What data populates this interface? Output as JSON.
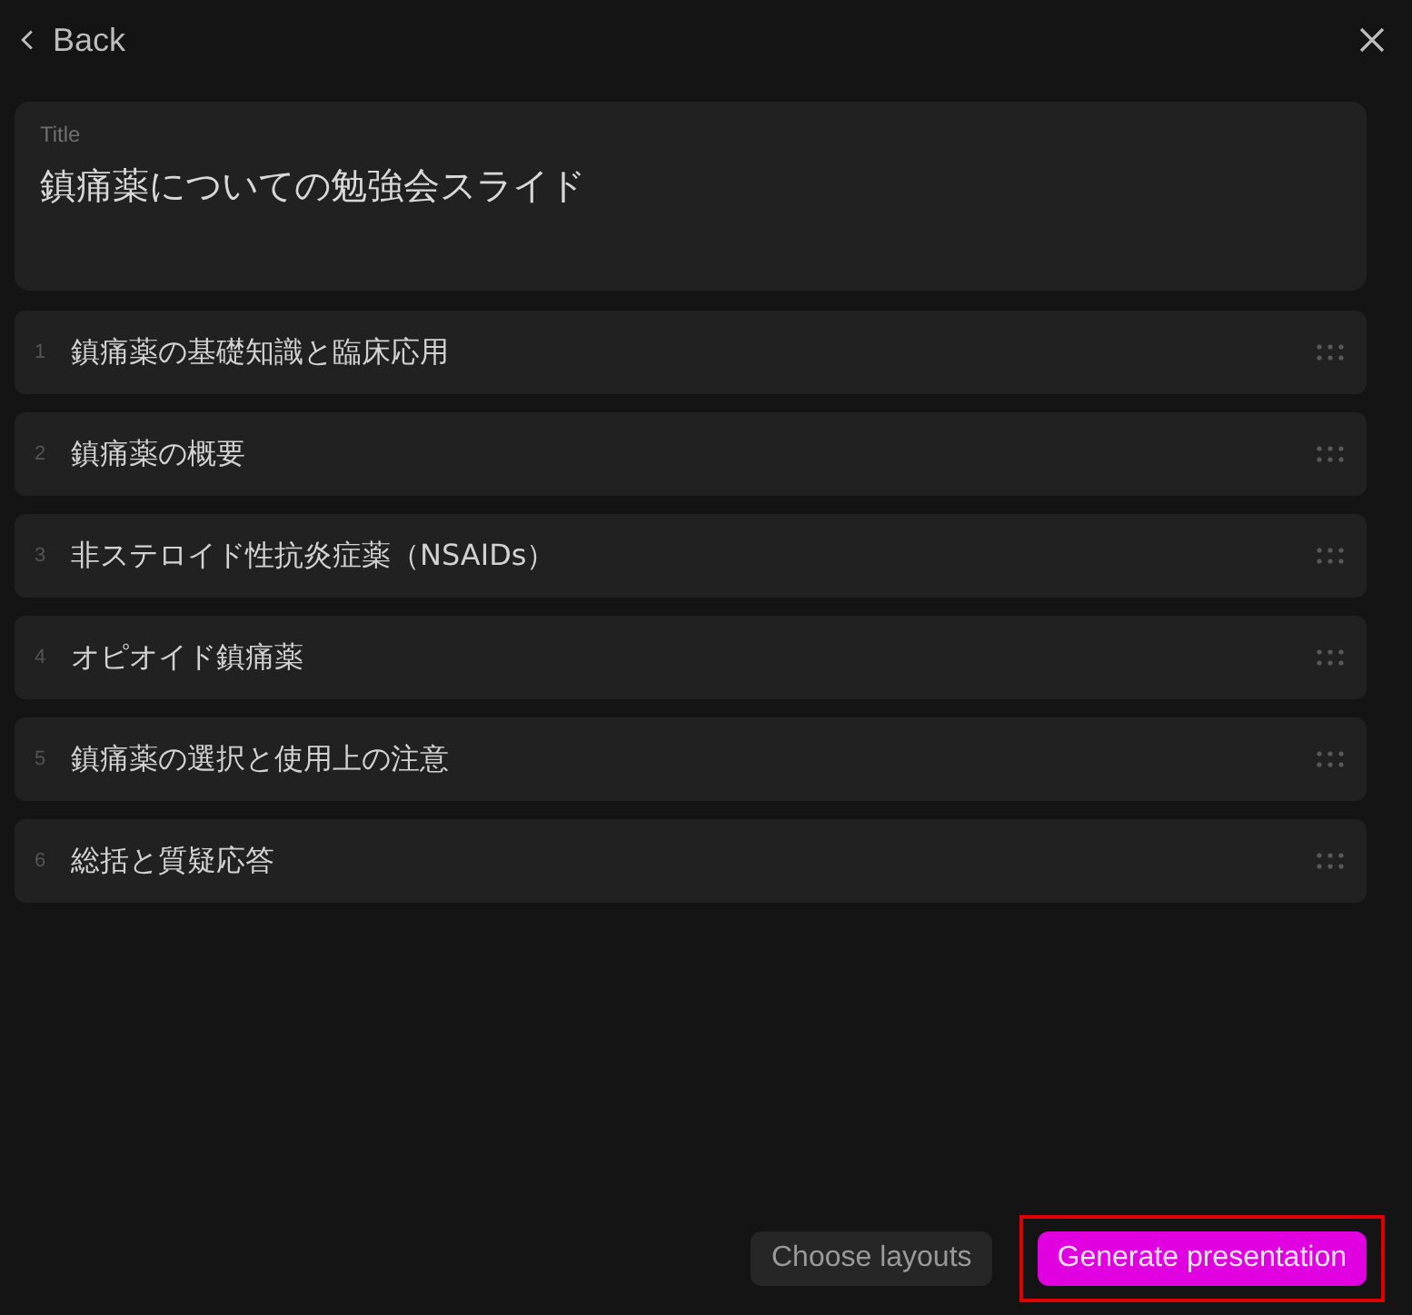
{
  "header": {
    "back_label": "Back"
  },
  "title_field": {
    "label": "Title",
    "value": "鎮痛薬についての勉強会スライド"
  },
  "outline": [
    {
      "number": "1",
      "text": "鎮痛薬の基礎知識と臨床応用"
    },
    {
      "number": "2",
      "text": "鎮痛薬の概要"
    },
    {
      "number": "3",
      "text": "非ステロイド性抗炎症薬（NSAIDs）"
    },
    {
      "number": "4",
      "text": "オピオイド鎮痛薬"
    },
    {
      "number": "5",
      "text": "鎮痛薬の選択と使用上の注意"
    },
    {
      "number": "6",
      "text": "総括と質疑応答"
    }
  ],
  "buttons": [
    {
      "label": "Choose layouts",
      "kind": "secondary",
      "highlighted": false
    },
    {
      "label": "Generate presentation",
      "kind": "primary",
      "highlighted": true
    }
  ]
}
